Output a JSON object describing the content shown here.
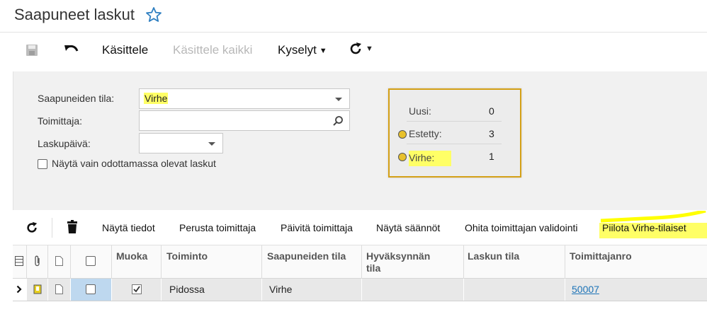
{
  "header": {
    "title": "Saapuneet laskut"
  },
  "toolbar": {
    "process_label": "Käsittele",
    "process_all_label": "Käsittele kaikki",
    "queries_label": "Kyselyt"
  },
  "filters": {
    "status_label": "Saapuneiden tila:",
    "status_value": "Virhe",
    "vendor_label": "Toimittaja:",
    "vendor_value": "",
    "invoice_date_label": "Laskupäivä:",
    "invoice_date_value": "",
    "pending_only_label": "Näytä vain odottamassa olevat laskut"
  },
  "summary": {
    "rows": [
      {
        "label": "Uusi:",
        "count": "0",
        "warning": false
      },
      {
        "label": "Estetty:",
        "count": "3",
        "warning": true
      },
      {
        "label": "Virhe:",
        "count": "1",
        "warning": true
      }
    ]
  },
  "grid_toolbar": {
    "buttons": [
      "Näytä tiedot",
      "Perusta toimittaja",
      "Päivitä toimittaja",
      "Näytä säännöt",
      "Ohita toimittajan validointi",
      "Piilota Virhe-tilaiset"
    ]
  },
  "grid": {
    "columns": [
      "Muoka",
      "Toiminto",
      "Saapuneiden tila",
      "Hyväksynnän tila",
      "Laskun tila",
      "Toimittajanro"
    ],
    "rows": [
      {
        "edit_checked": true,
        "action": "Pidossa",
        "incoming_status": "Virhe",
        "approval_status": "",
        "invoice_status": "",
        "vendor_no": "50007"
      }
    ]
  },
  "colors": {
    "highlight": "#ffff66",
    "summary_border": "#d4a016",
    "link": "#1c73b7",
    "selected": "#bed8ef"
  }
}
